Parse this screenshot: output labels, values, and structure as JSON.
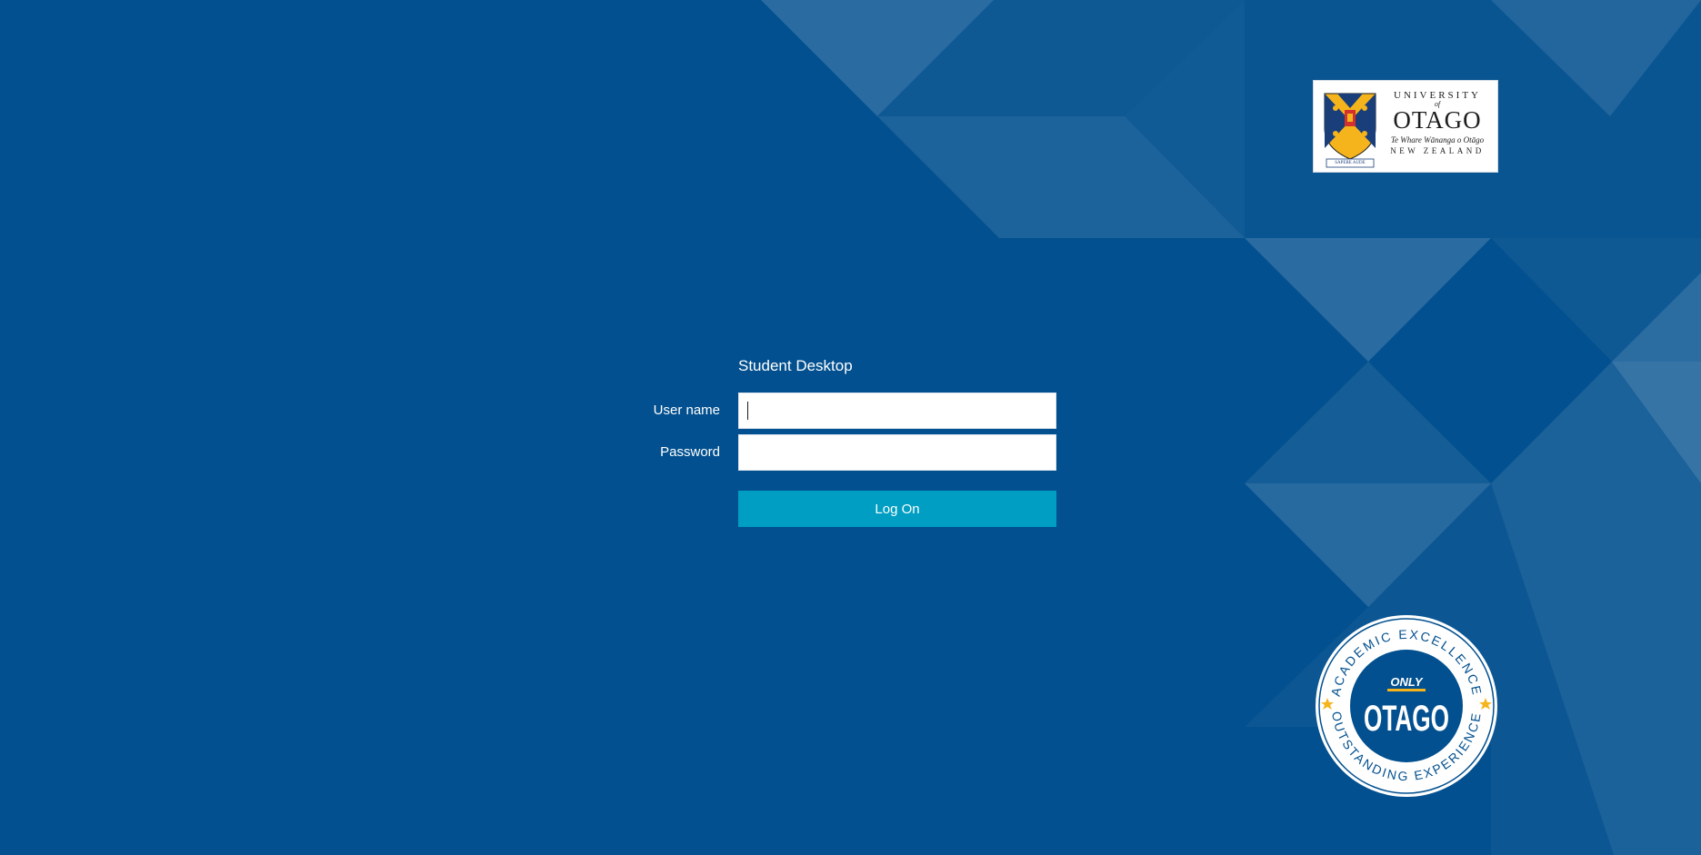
{
  "login": {
    "title": "Student Desktop",
    "username_label": "User name",
    "username_value": "",
    "password_label": "Password",
    "password_value": "",
    "logon_label": "Log On"
  },
  "university_logo": {
    "university": "UNIVERSITY",
    "of": "of",
    "otago": "OTAGO",
    "maori_name": "Te Whare Wānanga o Otāgo",
    "country": "NEW ZEALAND",
    "motto": "SAPERE AUDE"
  },
  "seal": {
    "top_text": "ACADEMIC EXCELLENCE",
    "bottom_text": "OUTSTANDING EXPERIENCE",
    "only": "ONLY",
    "otago": "OTAGO"
  },
  "colors": {
    "background": "#02508f",
    "button": "#009ec2",
    "seal_blue": "#02508f",
    "gold": "#f5b41c"
  }
}
